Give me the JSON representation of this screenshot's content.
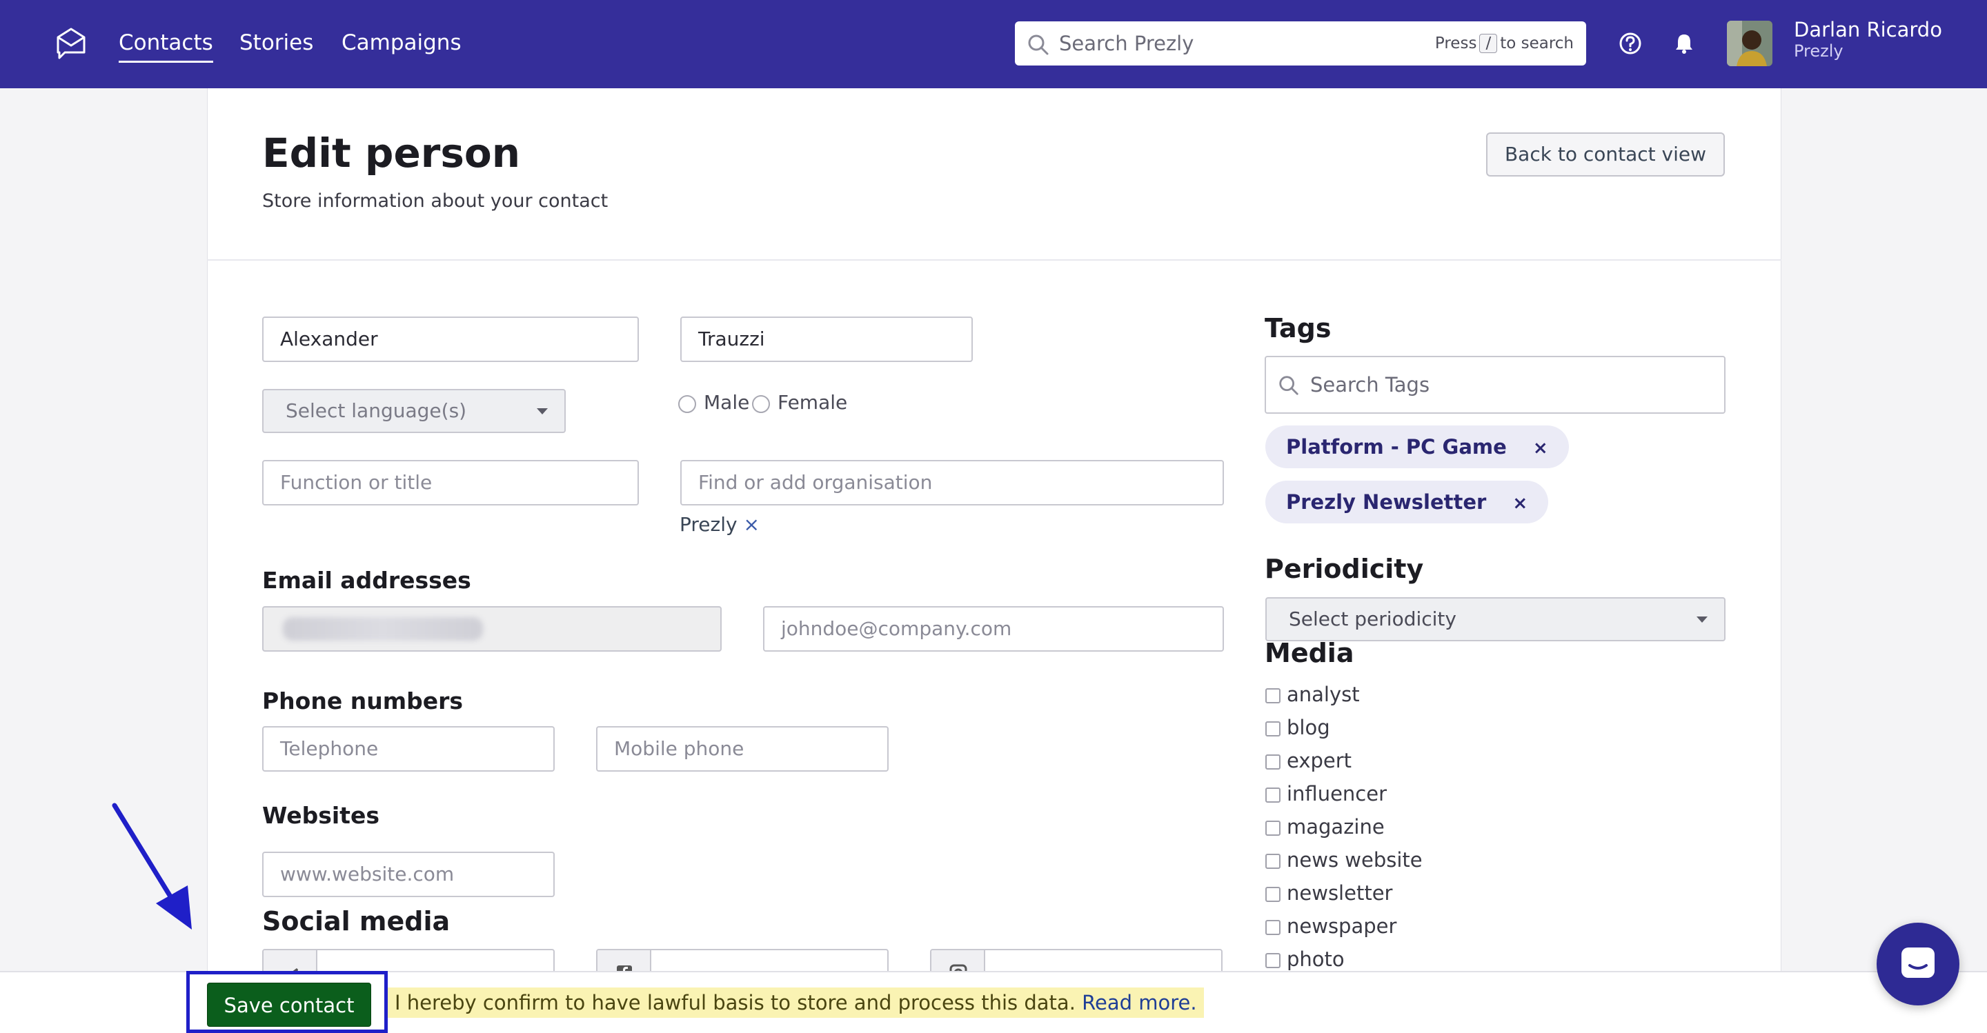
{
  "nav": {
    "links": [
      "Contacts",
      "Stories",
      "Campaigns"
    ],
    "search_placeholder": "Search Prezly",
    "search_hint_prefix": "Press",
    "search_hint_key": "/",
    "search_hint_suffix": "to search",
    "user_name": "Darlan Ricardo",
    "user_org": "Prezly"
  },
  "header": {
    "title": "Edit person",
    "subtitle": "Store information about your contact",
    "back_button": "Back to contact view"
  },
  "form": {
    "first_name": "Alexander",
    "last_name": "Trauzzi",
    "language_placeholder": "Select language(s)",
    "gender_male": "Male",
    "gender_female": "Female",
    "function_placeholder": "Function or title",
    "organisation_placeholder": "Find or add organisation",
    "organisation_chip": "Prezly",
    "organisation_chip_remove": "×",
    "email_title": "Email addresses",
    "email_placeholder": "johndoe@company.com",
    "phone_title": "Phone numbers",
    "telephone_placeholder": "Telephone",
    "mobile_placeholder": "Mobile phone",
    "websites_title": "Websites",
    "website_placeholder": "www.website.com",
    "social_title": "Social media"
  },
  "sidebar": {
    "tags_title": "Tags",
    "tags_search_placeholder": "Search Tags",
    "tags": [
      "Platform - PC Game",
      "Prezly Newsletter"
    ],
    "tag_remove": "×",
    "periodicity_title": "Periodicity",
    "periodicity_placeholder": "Select periodicity",
    "media_title": "Media",
    "media_options": [
      "analyst",
      "blog",
      "expert",
      "influencer",
      "magazine",
      "news website",
      "newsletter",
      "newspaper",
      "photo"
    ]
  },
  "footer": {
    "save_button": "Save contact",
    "consent_text": "I hereby confirm to have lawful basis to store and process this data.",
    "consent_link": "Read more."
  },
  "colors": {
    "nav_bg": "#352e9a",
    "save_bg": "#0b5e1c",
    "highlight": "#1f1fc8",
    "consent_bg": "#faf3b3",
    "tag_bg": "#ebebf6"
  }
}
